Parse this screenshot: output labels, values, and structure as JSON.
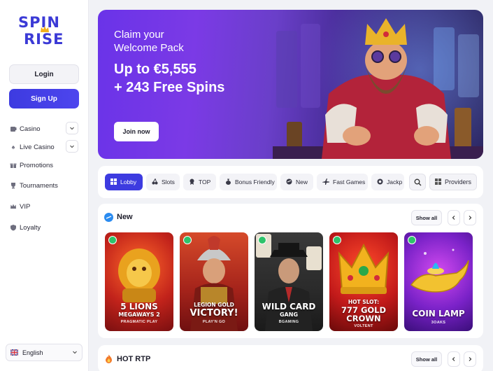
{
  "brand": {
    "line1": "SPIN",
    "line2": "RISE"
  },
  "auth": {
    "login_label": "Login",
    "signup_label": "Sign Up"
  },
  "sidebar": {
    "items": [
      {
        "label": "Casino",
        "icon": "slot-machine-icon",
        "expandable": true
      },
      {
        "label": "Live Casino",
        "icon": "spade-icon",
        "expandable": true
      },
      {
        "label": "Promotions",
        "icon": "gift-icon",
        "expandable": false
      },
      {
        "label": "Tournaments",
        "icon": "trophy-icon",
        "expandable": false
      },
      {
        "label": "VIP",
        "icon": "crown-icon",
        "expandable": false
      },
      {
        "label": "Loyalty",
        "icon": "shield-icon",
        "expandable": false
      }
    ],
    "language": {
      "label": "English",
      "flag": "uk-flag-icon"
    }
  },
  "hero": {
    "line1": "Claim your",
    "line2": "Welcome Pack",
    "offer1": "Up to €5,555",
    "offer2": "+ 243 Free Spins",
    "cta": "Join now"
  },
  "categories": {
    "items": [
      {
        "label": "Lobby",
        "icon": "lobby-icon",
        "active": true
      },
      {
        "label": "Slots",
        "icon": "cherries-icon",
        "active": false
      },
      {
        "label": "TOP",
        "icon": "medal-icon",
        "active": false
      },
      {
        "label": "Bonus Friendly",
        "icon": "money-bag-icon",
        "active": false
      },
      {
        "label": "New",
        "icon": "new-icon",
        "active": false
      },
      {
        "label": "Fast Games",
        "icon": "plane-icon",
        "active": false
      },
      {
        "label": "Jackp",
        "icon": "jackpot-icon",
        "active": false
      }
    ],
    "providers_label": "Providers"
  },
  "sections": {
    "new": {
      "title": "New",
      "show_all": "Show all",
      "games": [
        {
          "title1": "5 LIONS",
          "title2": "MEGAWAYS 2",
          "provider": "PRAGMATIC PLAY"
        },
        {
          "title1": "LEGION GOLD",
          "title2": "VICTORY!",
          "provider": "PLAY'N GO"
        },
        {
          "title1": "WILD CARD",
          "title2": "GANG",
          "provider": "BGAMING"
        },
        {
          "title1": "HOT SLOT:",
          "title2": "777 GOLD CROWN",
          "provider": "VOLTENT"
        },
        {
          "title1": "COIN LAMP",
          "title2": "",
          "provider": "3OAKS"
        }
      ]
    },
    "hot_rtp": {
      "title": "HOT RTP",
      "show_all": "Show all"
    }
  },
  "colors": {
    "accent": "#3d3be0",
    "badge": "#2ec36b"
  }
}
